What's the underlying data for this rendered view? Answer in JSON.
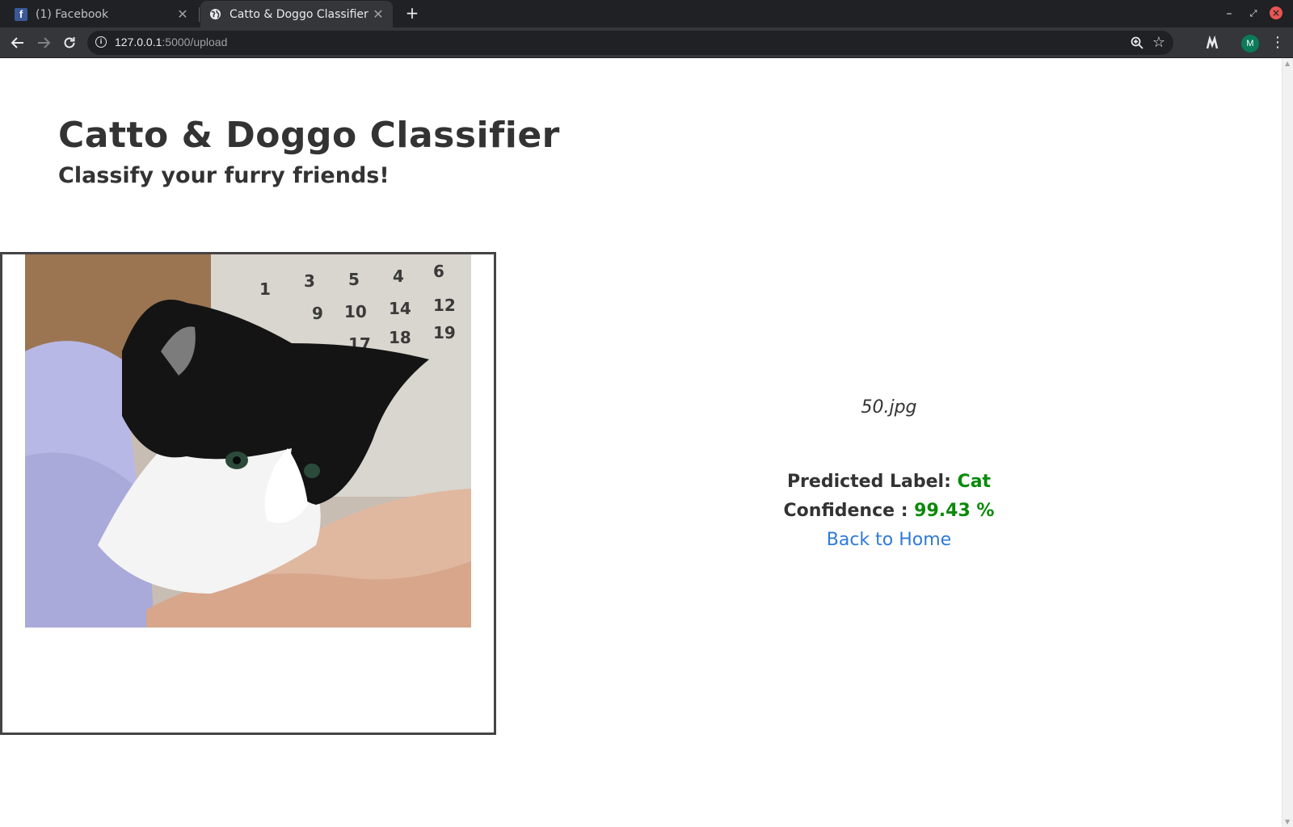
{
  "browser": {
    "tabs": [
      {
        "title": "(1) Facebook",
        "icon": "facebook-icon",
        "active": false
      },
      {
        "title": "Catto & Doggo Classifier",
        "icon": "globe-icon",
        "active": true
      }
    ],
    "url_host": "127.0.0.1",
    "url_path": ":5000/upload",
    "profile_initial": "M"
  },
  "page": {
    "title": "Catto & Doggo Classifier",
    "subtitle": "Classify your furry friends!",
    "image": {
      "alt": "black and white kitten biting a hand"
    },
    "filename": "50.jpg",
    "predicted_label_text": "Predicted Label: ",
    "predicted_label_value": "Cat",
    "confidence_text": "Confidence : ",
    "confidence_value": "99.43 %",
    "back_link": "Back to Home"
  },
  "colors": {
    "result_value": "#0a8a0a",
    "link": "#2f7ad8",
    "text": "#333333"
  }
}
